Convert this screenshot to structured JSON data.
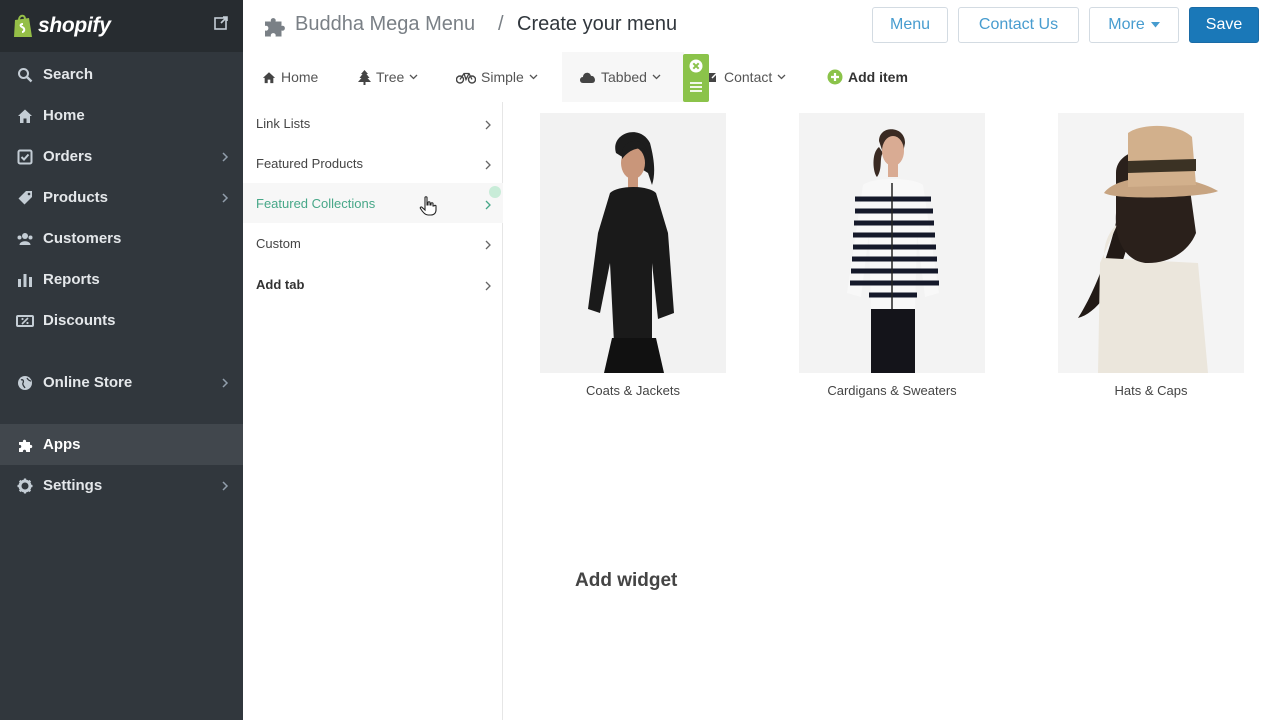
{
  "sidebar": {
    "brand": "shopify",
    "items": [
      {
        "label": "Search",
        "icon": "search-icon",
        "chevron": false
      },
      {
        "label": "Home",
        "icon": "home-icon",
        "chevron": false
      },
      {
        "label": "Orders",
        "icon": "orders-icon",
        "chevron": true
      },
      {
        "label": "Products",
        "icon": "tag-icon",
        "chevron": true
      },
      {
        "label": "Customers",
        "icon": "customers-icon",
        "chevron": false
      },
      {
        "label": "Reports",
        "icon": "bar-chart-icon",
        "chevron": false
      },
      {
        "label": "Discounts",
        "icon": "discount-icon",
        "chevron": false
      },
      {
        "label": "Online Store",
        "icon": "globe-icon",
        "chevron": true
      },
      {
        "label": "Apps",
        "icon": "puzzle-icon",
        "chevron": false,
        "active": true
      },
      {
        "label": "Settings",
        "icon": "gear-icon",
        "chevron": true
      }
    ]
  },
  "header": {
    "breadcrumb": "Buddha Mega Menu",
    "separator": "/",
    "title": "Create your menu",
    "buttons": {
      "menu": "Menu",
      "contact": "Contact Us",
      "more": "More",
      "save": "Save"
    }
  },
  "menubar": {
    "items": [
      {
        "label": "Home",
        "icon": "home-icon"
      },
      {
        "label": "Tree",
        "icon": "tree-icon"
      },
      {
        "label": "Simple",
        "icon": "bicycle-icon"
      },
      {
        "label": "Tabbed",
        "icon": "cloud-icon"
      },
      {
        "label": "Contact",
        "icon": "edit-icon"
      },
      {
        "label": "Add item",
        "icon": "plus-circle-icon"
      }
    ]
  },
  "tabs": {
    "items": [
      "Link Lists",
      "Featured Products",
      "Featured Collections",
      "Custom",
      "Add tab"
    ],
    "selected": "Featured Collections"
  },
  "collections": [
    {
      "caption": "Coats & Jackets"
    },
    {
      "caption": "Cardigans & Sweaters"
    },
    {
      "caption": "Hats & Caps"
    }
  ],
  "widget": {
    "add_label": "Add widget"
  },
  "colors": {
    "sidebar": "#31373d",
    "accent": "#479ccf",
    "save": "#1a78b8",
    "green": "#8bc34a",
    "highlight_text": "#47a788"
  }
}
